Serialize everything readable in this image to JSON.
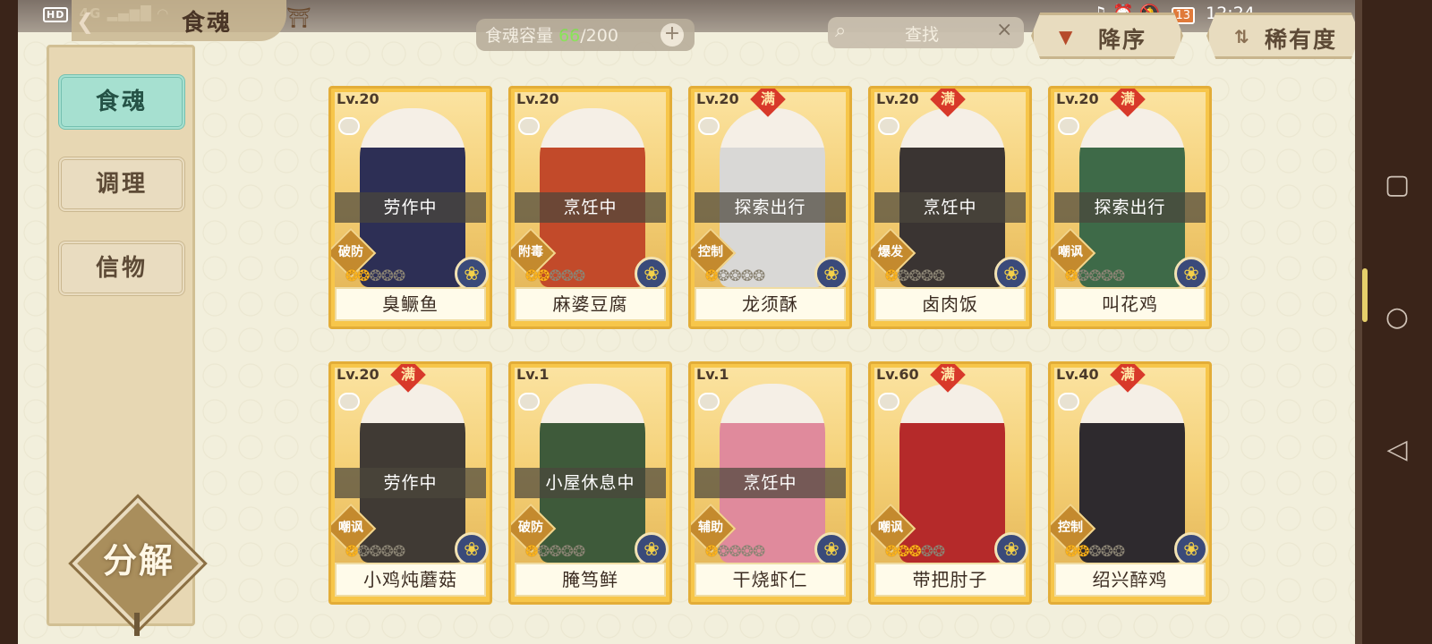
{
  "status_bar": {
    "left_text": "4G",
    "hd": "HD",
    "battery": "13",
    "time": "12:24"
  },
  "header": {
    "back_icon": "back-arrow-icon",
    "title": "食魂",
    "home_icon": "pagoda-icon"
  },
  "capacity": {
    "label": "食魂容量",
    "current": "66",
    "separator": "/200",
    "add": "+"
  },
  "search": {
    "placeholder": "查找",
    "clear": "×"
  },
  "sort": {
    "order_label": "降序",
    "rarity_label": "稀有度"
  },
  "sidebar": {
    "tabs": [
      {
        "label": "食魂",
        "active": true
      },
      {
        "label": "调理",
        "active": false
      },
      {
        "label": "信物",
        "active": false
      }
    ],
    "decompose_label": "分解"
  },
  "cards": [
    {
      "level": "Lv.20",
      "full": "",
      "status": "劳作中",
      "role": "破防",
      "stars_on": 2,
      "stars_off": 3,
      "name": "臭鳜鱼",
      "art_color": "#2d2f55",
      "elem": "indigo"
    },
    {
      "level": "Lv.20",
      "full": "",
      "status": "烹饪中",
      "role": "附毒",
      "stars_on": 2,
      "stars_off": 3,
      "name": "麻婆豆腐",
      "art_color": "#c24a2a",
      "elem": "indigo"
    },
    {
      "level": "Lv.20",
      "full": "满",
      "status": "探索出行",
      "role": "控制",
      "stars_on": 1,
      "stars_off": 4,
      "name": "龙须酥",
      "art_color": "#d9d8d6",
      "elem": "indigo"
    },
    {
      "level": "Lv.20",
      "full": "满",
      "status": "烹饪中",
      "role": "爆发",
      "stars_on": 1,
      "stars_off": 4,
      "name": "卤肉饭",
      "art_color": "#3a3432",
      "elem": "indigo"
    },
    {
      "level": "Lv.20",
      "full": "满",
      "status": "探索出行",
      "role": "嘲讽",
      "stars_on": 1,
      "stars_off": 4,
      "name": "叫花鸡",
      "art_color": "#3e6a48",
      "elem": "indigo"
    },
    {
      "level": "Lv.20",
      "full": "满",
      "status": "劳作中",
      "role": "嘲讽",
      "stars_on": 1,
      "stars_off": 4,
      "name": "小鸡炖蘑菇",
      "art_color": "#403a34",
      "elem": "indigo"
    },
    {
      "level": "Lv.1",
      "full": "",
      "status": "小屋休息中",
      "role": "破防",
      "stars_on": 1,
      "stars_off": 4,
      "name": "腌笃鲜",
      "art_color": "#3e5a3a",
      "elem": "indigo"
    },
    {
      "level": "Lv.1",
      "full": "",
      "status": "烹饪中",
      "role": "辅助",
      "stars_on": 1,
      "stars_off": 4,
      "name": "干烧虾仁",
      "art_color": "#e08a9c",
      "elem": "indigo"
    },
    {
      "level": "Lv.60",
      "full": "满",
      "status": "",
      "role": "嘲讽",
      "stars_on": 3,
      "stars_off": 2,
      "name": "带把肘子",
      "art_color": "#b52a2a",
      "elem": "indigo"
    },
    {
      "level": "Lv.40",
      "full": "满",
      "status": "",
      "role": "控制",
      "stars_on": 2,
      "stars_off": 3,
      "name": "绍兴醉鸡",
      "art_color": "#2e2a2e",
      "elem": "indigo"
    }
  ]
}
